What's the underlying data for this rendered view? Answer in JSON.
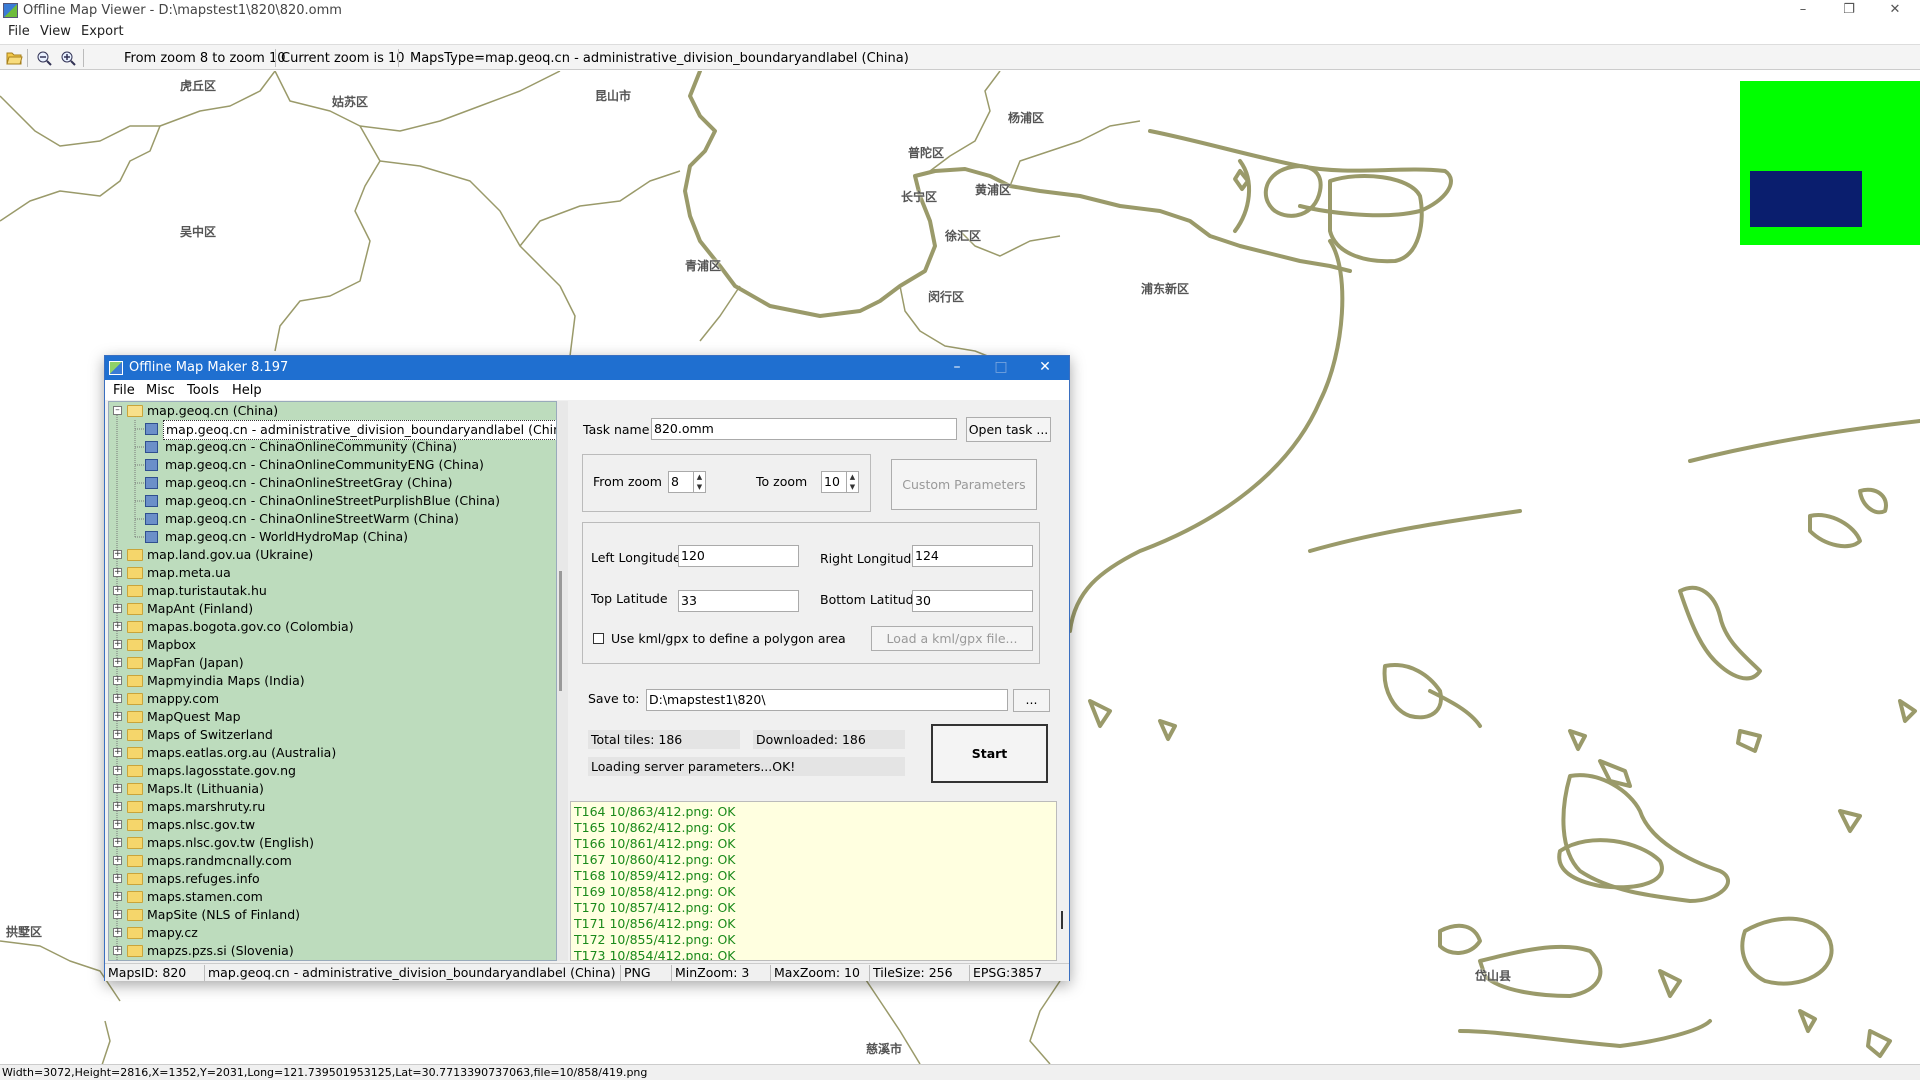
{
  "main_window": {
    "title": "Offline Map Viewer - D:\\mapstest1\\820\\820.omm",
    "menu": [
      "File",
      "View",
      "Export"
    ],
    "toolbar": {
      "zoom_range": "From zoom 8 to zoom 10",
      "current_zoom": "Current zoom is 10",
      "maps_type": "MapsType=map.geoq.cn - administrative_division_boundaryandlabel (China)",
      "icons": [
        "folder-open-icon",
        "zoom-out-icon",
        "zoom-in-icon"
      ]
    },
    "status": "Width=3072,Height=2816,X=1352,Y=2031,Long=121.739501953125,Lat=30.7713390737063,file=10/858/419.png"
  },
  "map": {
    "labels": [
      "虎丘区",
      "姑苏区",
      "昆山市",
      "杨浦区",
      "普陀区",
      "黄浦区",
      "长宁区",
      "徐汇区",
      "吴中区",
      "青浦区",
      "闵行区",
      "浦东新区",
      "拱墅区",
      "岱山县",
      "慈溪市"
    ],
    "boundary_color": "#9a9a6a",
    "minimap_color": "#00ff00",
    "minimap_view_color": "#0a1e6e"
  },
  "dialog": {
    "title": "Offline Map Maker 8.197",
    "menu": [
      "File",
      "Misc",
      "Tools",
      "Help"
    ],
    "tree": {
      "root": "map.geoq.cn (China)",
      "children": [
        "map.geoq.cn - administrative_division_boundaryandlabel (China)",
        "map.geoq.cn - ChinaOnlineCommunity (China)",
        "map.geoq.cn - ChinaOnlineCommunityENG (China)",
        "map.geoq.cn - ChinaOnlineStreetGray (China)",
        "map.geoq.cn - ChinaOnlineStreetPurplishBlue (China)",
        "map.geoq.cn - ChinaOnlineStreetWarm (China)",
        "map.geoq.cn - WorldHydroMap (China)"
      ],
      "folders": [
        "map.land.gov.ua (Ukraine)",
        "map.meta.ua",
        "map.turistautak.hu",
        "MapAnt (Finland)",
        "mapas.bogota.gov.co (Colombia)",
        "Mapbox",
        "MapFan (Japan)",
        "Mapmyindia Maps (India)",
        "mappy.com",
        "MapQuest Map",
        "Maps of Switzerland",
        "maps.eatlas.org.au (Australia)",
        "maps.lagosstate.gov.ng",
        "Maps.lt (Lithuania)",
        "maps.marshruty.ru",
        "maps.nlsc.gov.tw",
        "maps.nlsc.gov.tw (English)",
        "maps.randmcnally.com",
        "maps.refuges.info",
        "maps.stamen.com",
        "MapSite (NLS of Finland)",
        "mapy.cz",
        "mapzs.pzs.si (Slovenia)"
      ]
    },
    "form": {
      "task_name_label": "Task name",
      "task_name_value": "820.omm",
      "open_task_button": "Open task ...",
      "from_zoom_label": "From zoom",
      "from_zoom_value": "8",
      "to_zoom_label": "To zoom",
      "to_zoom_value": "10",
      "custom_params_button": "Custom Parameters",
      "left_lon_label": "Left Longitude",
      "left_lon_value": "120",
      "right_lon_label": "Right Longitude",
      "right_lon_value": "124",
      "top_lat_label": "Top Latitude",
      "top_lat_value": "33",
      "bottom_lat_label": "Bottom Latitude",
      "bottom_lat_value": "30",
      "kml_checkbox_label": "Use kml/gpx to define a polygon area",
      "kml_load_button": "Load a kml/gpx file...",
      "save_to_label": "Save to:",
      "save_to_value": "D:\\mapstest1\\820\\",
      "browse_button": "...",
      "total_tiles": "Total tiles: 186",
      "downloaded": "Downloaded: 186",
      "loading_status": "Loading server parameters...OK!",
      "start_button": "Start"
    },
    "log": [
      "T164 10/863/412.png: OK",
      "T165 10/862/412.png: OK",
      "T166 10/861/412.png: OK",
      "T167 10/860/412.png: OK",
      "T168 10/859/412.png: OK",
      "T169 10/858/412.png: OK",
      "T170 10/857/412.png: OK",
      "T171 10/856/412.png: OK",
      "T172 10/855/412.png: OK",
      "T173 10/854/412.png: OK"
    ],
    "status": {
      "maps_id": "MapsID: 820",
      "map_name": "map.geoq.cn - administrative_division_boundaryandlabel (China)",
      "format": "PNG",
      "min_zoom": "MinZoom: 3",
      "max_zoom": "MaxZoom: 10",
      "tile_size": "TileSize: 256",
      "epsg": "EPSG:3857"
    }
  }
}
